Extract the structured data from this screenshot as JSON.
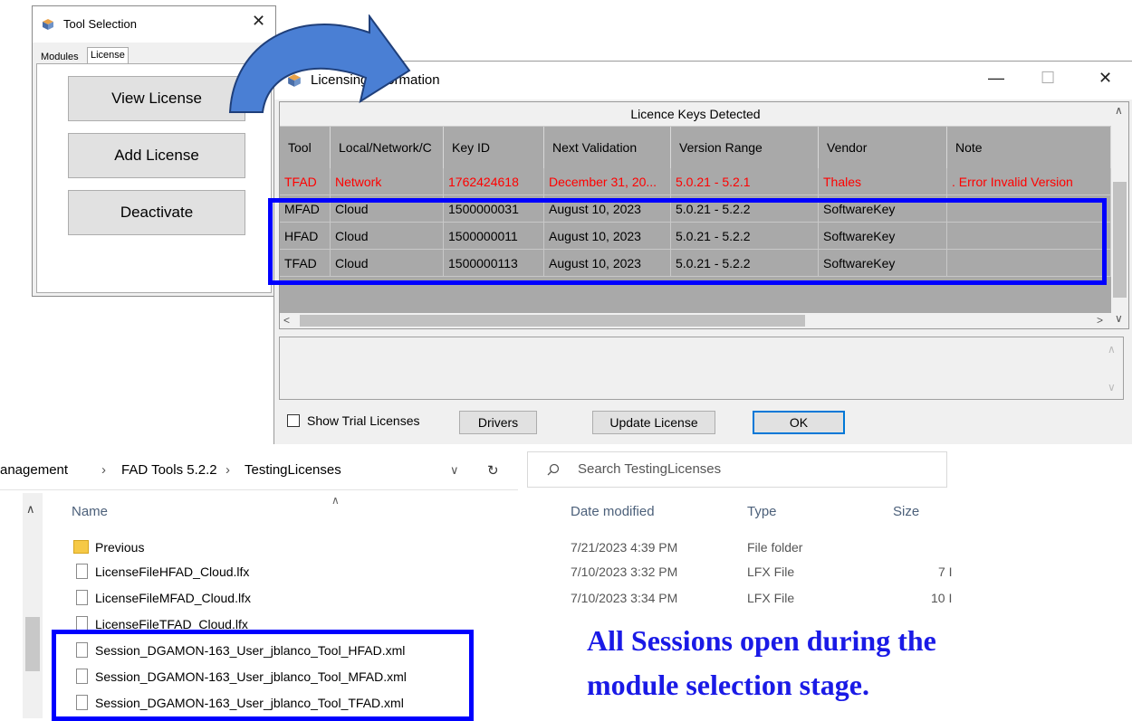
{
  "tool_window": {
    "title": "Tool Selection",
    "close": "✕",
    "tabs": [
      "Modules",
      "License"
    ],
    "buttons": {
      "view": "View License",
      "add": "Add License",
      "deactivate": "Deactivate"
    }
  },
  "license_window": {
    "title": "Licensing Information",
    "controls": {
      "minimize": "—",
      "maximize": "☐",
      "close": "✕"
    },
    "grid_caption": "Licence Keys Detected",
    "columns": [
      "Tool",
      "Local/Network/C",
      "Key ID",
      "Next Validation",
      "Version Range",
      "Vendor",
      "Note"
    ],
    "rows": [
      [
        "TFAD",
        "Network",
        "1762424618",
        "December 31, 20...",
        "5.0.21 - 5.2.1",
        "Thales",
        ". Error Invalid Version"
      ],
      [
        "MFAD",
        "Cloud",
        "1500000031",
        "August 10, 2023",
        "5.0.21 - 5.2.2",
        "SoftwareKey",
        ""
      ],
      [
        "HFAD",
        "Cloud",
        "1500000011",
        "August 10, 2023",
        "5.0.21 - 5.2.2",
        "SoftwareKey",
        ""
      ],
      [
        "TFAD",
        "Cloud",
        "1500000113",
        "August 10, 2023",
        "5.0.21 - 5.2.2",
        "SoftwareKey",
        ""
      ]
    ],
    "show_trial_label": "Show Trial Licenses",
    "buttons": {
      "drivers": "Drivers",
      "update": "Update License",
      "ok": "OK"
    }
  },
  "explorer": {
    "breadcrumbs": [
      "anagement",
      "FAD Tools 5.2.2",
      "TestingLicenses"
    ],
    "search_placeholder": "Search TestingLicenses",
    "columns": {
      "name": "Name",
      "date": "Date modified",
      "type": "Type",
      "size": "Size"
    },
    "files": [
      {
        "name": "Previous",
        "date": "7/21/2023 4:39 PM",
        "type": "File folder",
        "size": "",
        "kind": "folder"
      },
      {
        "name": "LicenseFileHFAD_Cloud.lfx",
        "date": "7/10/2023 3:32 PM",
        "type": "LFX File",
        "size": "7 I",
        "kind": "file"
      },
      {
        "name": "LicenseFileMFAD_Cloud.lfx",
        "date": "7/10/2023 3:34 PM",
        "type": "LFX File",
        "size": "10 I",
        "kind": "file"
      },
      {
        "name": "LicenseFileTFAD_Cloud.lfx",
        "date": "",
        "type": "",
        "size": "",
        "kind": "file"
      },
      {
        "name": "Session_DGAMON-163_User_jblanco_Tool_HFAD.xml",
        "date": "",
        "type": "",
        "size": "",
        "kind": "file"
      },
      {
        "name": "Session_DGAMON-163_User_jblanco_Tool_MFAD.xml",
        "date": "",
        "type": "",
        "size": "",
        "kind": "file"
      },
      {
        "name": "Session_DGAMON-163_User_jblanco_Tool_TFAD.xml",
        "date": "",
        "type": "",
        "size": "",
        "kind": "file"
      }
    ]
  },
  "annotation": {
    "line1": "All Sessions open during the",
    "line2": "module selection stage."
  },
  "colors": {
    "highlight": "#0000ff",
    "arrow_fill": "#4a7fd4",
    "error_text": "#ff0000",
    "annotation_text": "#1a1ae6"
  }
}
